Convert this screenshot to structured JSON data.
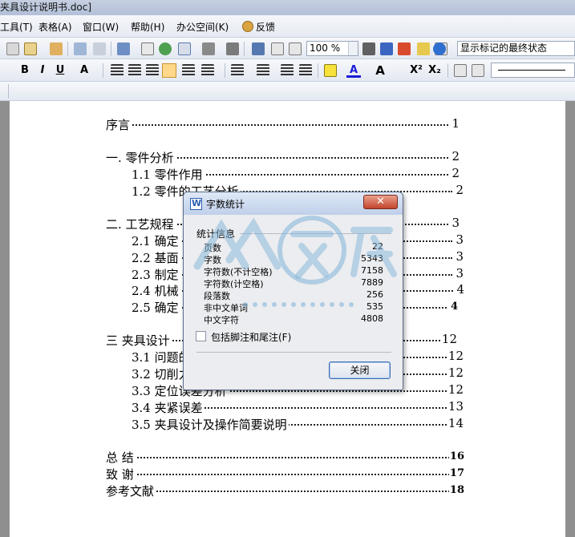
{
  "window": {
    "title": "夹具设计说明书.doc]"
  },
  "menu": {
    "items": [
      "工具(T)",
      "表格(A)",
      "窗口(W)",
      "帮助(H)",
      "办公空间(K)",
      "反馈"
    ]
  },
  "toolbar": {
    "zoom": "100 %",
    "track_changes_mode": "显示标记的最终状态",
    "format_buttons": [
      "B",
      "I",
      "U",
      "A",
      "A",
      "A",
      "X²",
      "X₂"
    ]
  },
  "toc": [
    {
      "text": "序言",
      "page": "1"
    },
    {
      "text": "一. 零件分析",
      "page": "2"
    },
    {
      "text": "1.1 零件作用",
      "page": "2"
    },
    {
      "text": "1.2 零件的工艺分析",
      "page": "2"
    },
    {
      "text": "二. 工艺规程",
      "page": "3"
    },
    {
      "text": "2.1 确定",
      "page": "3"
    },
    {
      "text": "2.2 基面",
      "page": "3"
    },
    {
      "text": "2.3 制定",
      "page": "3"
    },
    {
      "text": "2.4 机械",
      "page": "4"
    },
    {
      "text": "2.5 确定",
      "page": "4"
    },
    {
      "text": "三  夹具设计",
      "page": "12"
    },
    {
      "text": "3.1 问题的",
      "page": "12"
    },
    {
      "text": "3.2 切削力",
      "page": "12"
    },
    {
      "text": "3.3 定位误差分析",
      "page": "12"
    },
    {
      "text": "3.4 夹紧误差",
      "page": "13"
    },
    {
      "text": "3.5 夹具设计及操作简要说明",
      "page": "14"
    },
    {
      "text": "总  结",
      "page": "16"
    },
    {
      "text": "致  谢",
      "page": "17"
    },
    {
      "text": "参考文献",
      "page": "18"
    }
  ],
  "dialog": {
    "title": "字数统计",
    "group_label": "统计信息",
    "stats": [
      {
        "label": "页数",
        "value": "22"
      },
      {
        "label": "字数",
        "value": "5343"
      },
      {
        "label": "字符数(不计空格)",
        "value": "7158"
      },
      {
        "label": "字符数(计空格)",
        "value": "7889"
      },
      {
        "label": "段落数",
        "value": "256"
      },
      {
        "label": "非中文单词",
        "value": "535"
      },
      {
        "label": "中文字符",
        "value": "4808"
      }
    ],
    "checkbox_label": "包括脚注和尾注(F)",
    "checkbox_checked": false,
    "close_button": "关闭"
  },
  "watermark": {
    "text": "人人文库",
    "url": "www.renrendoc.com"
  }
}
